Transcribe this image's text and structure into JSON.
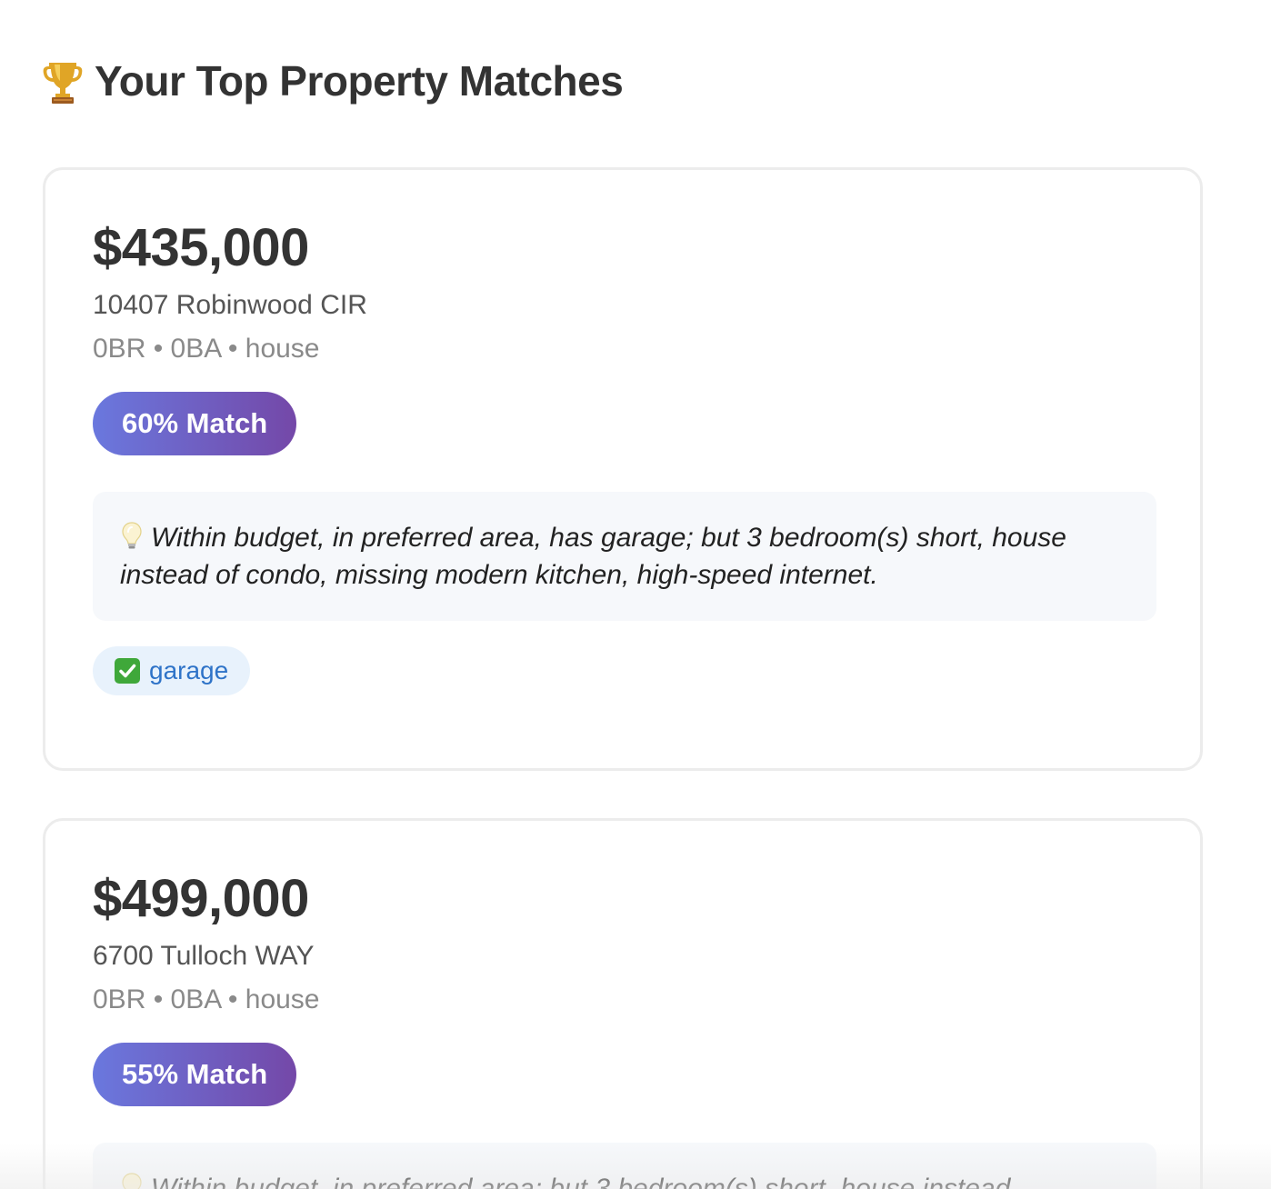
{
  "header": {
    "title": "Your Top Property Matches",
    "icon": "trophy-icon"
  },
  "properties": [
    {
      "price": "$435,000",
      "address": "10407 Robinwood CIR",
      "meta": "0BR • 0BA • house",
      "match": "60% Match",
      "reason": "Within budget, in preferred area, has garage; but 3 bedroom(s) short, house instead of condo, missing modern kitchen, high-speed internet.",
      "features": [
        "garage"
      ]
    },
    {
      "price": "$499,000",
      "address": "6700 Tulloch WAY",
      "meta": "0BR • 0BA • house",
      "match": "55% Match",
      "reason": "Within budget, in preferred area; but 3 bedroom(s) short, house instead"
    }
  ],
  "colors": {
    "badge_gradient_start": "#6a78de",
    "badge_gradient_end": "#7448a8",
    "chip_bg": "#e8f2fc",
    "chip_text": "#2e73c8",
    "reason_bg": "#f6f8fb"
  }
}
